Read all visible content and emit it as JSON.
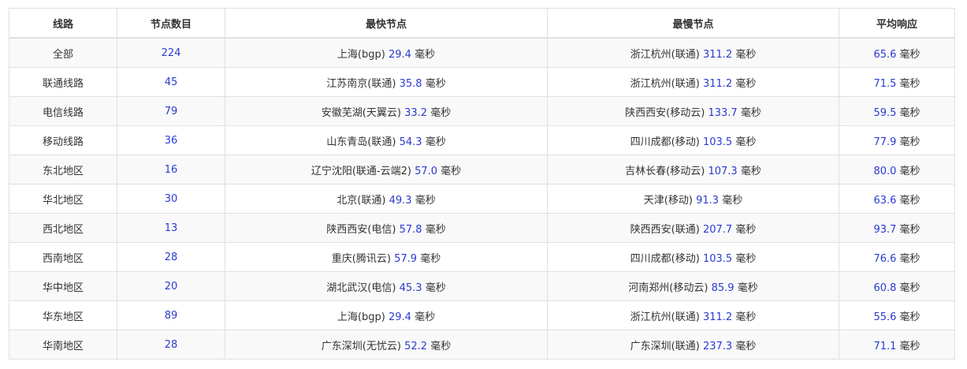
{
  "colors": {
    "number": "#2b3bd1",
    "text": "#333333",
    "border": "#e0e0e0",
    "stripe": "#f9f9f9"
  },
  "table": {
    "headers": [
      "线路",
      "节点数目",
      "最快节点",
      "最慢节点",
      "平均响应"
    ],
    "unit": "毫秒",
    "rows": [
      {
        "line": "全部",
        "count": "224",
        "fast_node": "上海(bgp)",
        "fast_ms": "29.4",
        "slow_node": "浙江杭州(联通)",
        "slow_ms": "311.2",
        "avg_ms": "65.6"
      },
      {
        "line": "联通线路",
        "count": "45",
        "fast_node": "江苏南京(联通)",
        "fast_ms": "35.8",
        "slow_node": "浙江杭州(联通)",
        "slow_ms": "311.2",
        "avg_ms": "71.5"
      },
      {
        "line": "电信线路",
        "count": "79",
        "fast_node": "安徽芜湖(天翼云)",
        "fast_ms": "33.2",
        "slow_node": "陕西西安(移动云)",
        "slow_ms": "133.7",
        "avg_ms": "59.5"
      },
      {
        "line": "移动线路",
        "count": "36",
        "fast_node": "山东青岛(联通)",
        "fast_ms": "54.3",
        "slow_node": "四川成都(移动)",
        "slow_ms": "103.5",
        "avg_ms": "77.9"
      },
      {
        "line": "东北地区",
        "count": "16",
        "fast_node": "辽宁沈阳(联通-云端2)",
        "fast_ms": "57.0",
        "slow_node": "吉林长春(移动云)",
        "slow_ms": "107.3",
        "avg_ms": "80.0"
      },
      {
        "line": "华北地区",
        "count": "30",
        "fast_node": "北京(联通)",
        "fast_ms": "49.3",
        "slow_node": "天津(移动)",
        "slow_ms": "91.3",
        "avg_ms": "63.6"
      },
      {
        "line": "西北地区",
        "count": "13",
        "fast_node": "陕西西安(电信)",
        "fast_ms": "57.8",
        "slow_node": "陕西西安(联通)",
        "slow_ms": "207.7",
        "avg_ms": "93.7"
      },
      {
        "line": "西南地区",
        "count": "28",
        "fast_node": "重庆(腾讯云)",
        "fast_ms": "57.9",
        "slow_node": "四川成都(移动)",
        "slow_ms": "103.5",
        "avg_ms": "76.6"
      },
      {
        "line": "华中地区",
        "count": "20",
        "fast_node": "湖北武汉(电信)",
        "fast_ms": "45.3",
        "slow_node": "河南郑州(移动云)",
        "slow_ms": "85.9",
        "avg_ms": "60.8"
      },
      {
        "line": "华东地区",
        "count": "89",
        "fast_node": "上海(bgp)",
        "fast_ms": "29.4",
        "slow_node": "浙江杭州(联通)",
        "slow_ms": "311.2",
        "avg_ms": "55.6"
      },
      {
        "line": "华南地区",
        "count": "28",
        "fast_node": "广东深圳(无忧云)",
        "fast_ms": "52.2",
        "slow_node": "广东深圳(联通)",
        "slow_ms": "237.3",
        "avg_ms": "71.1"
      }
    ]
  }
}
